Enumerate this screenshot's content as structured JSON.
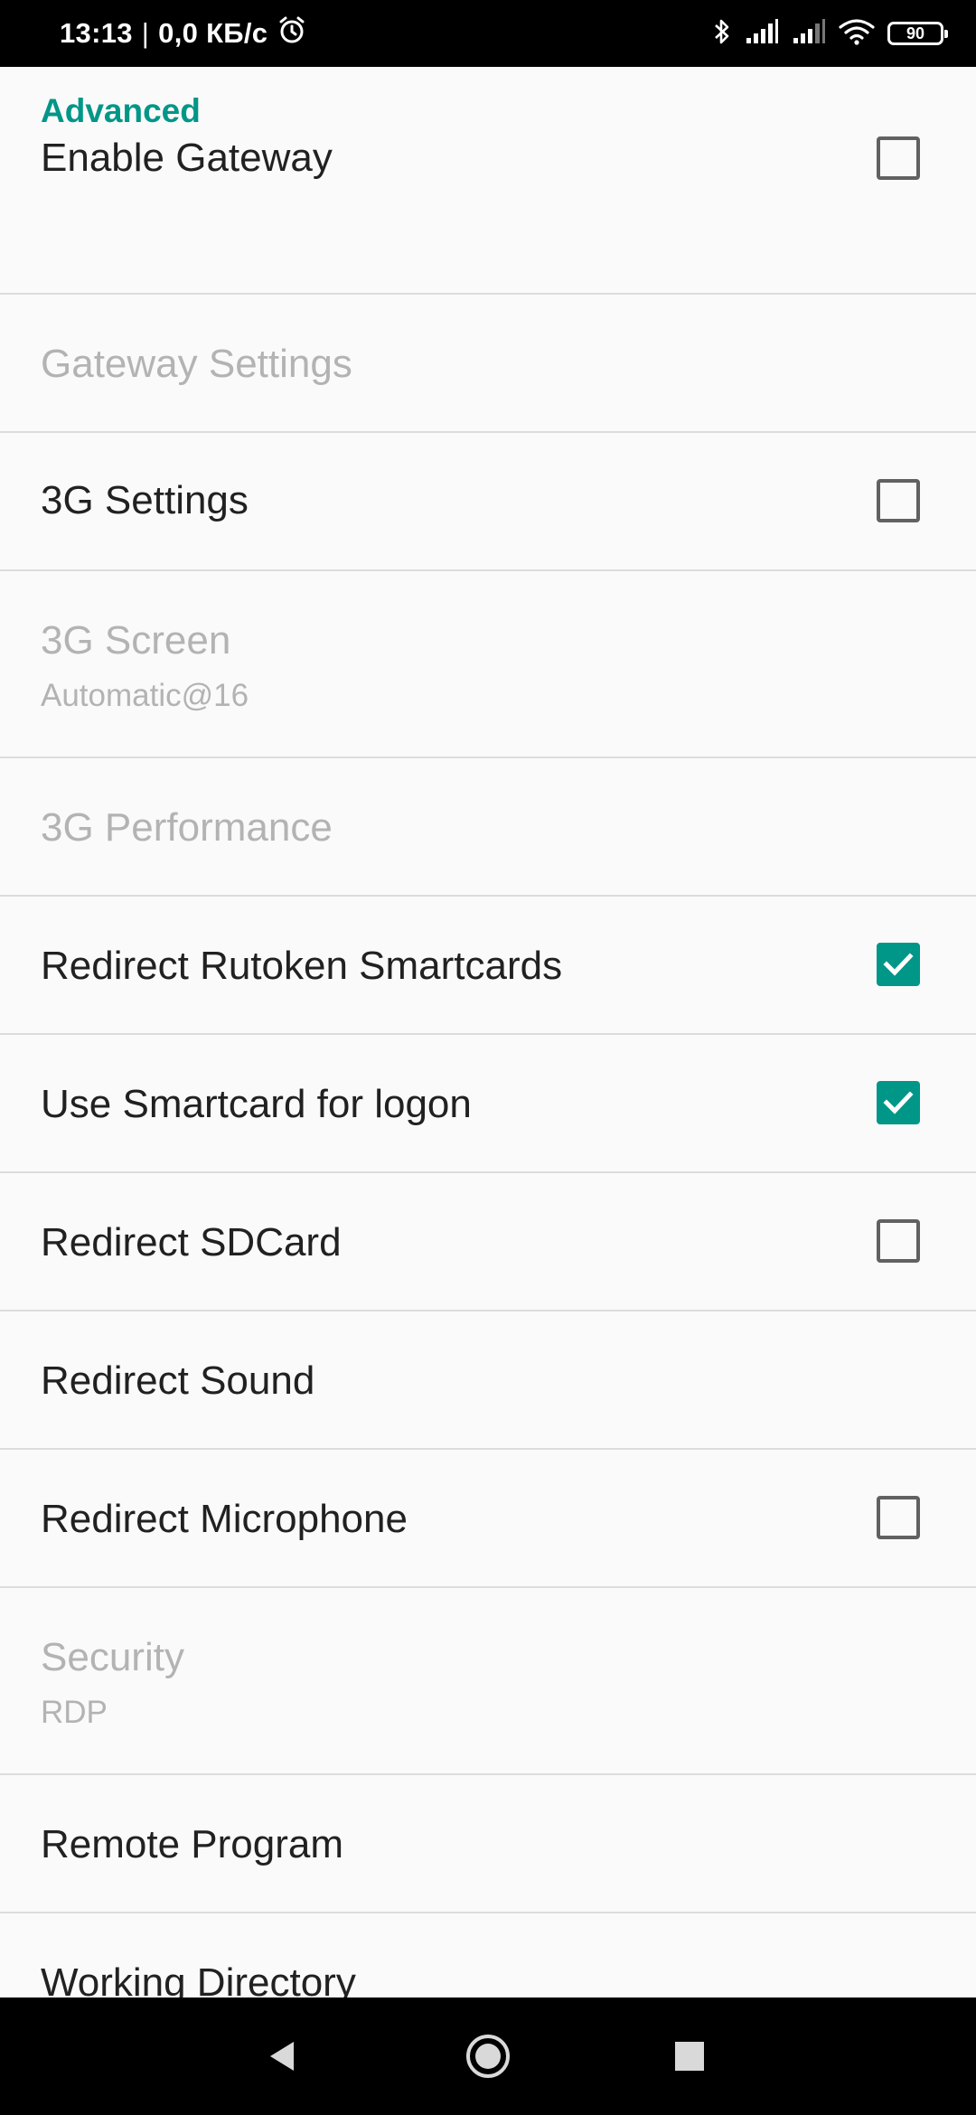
{
  "status_bar": {
    "time": "13:13",
    "separator": "|",
    "network_speed": "0,0 КБ/с",
    "battery_level": "90",
    "icons": [
      "alarm-icon",
      "bluetooth-icon",
      "signal-icon",
      "signal-icon",
      "wifi-icon",
      "battery-icon"
    ]
  },
  "settings": {
    "category": "Advanced",
    "items": [
      {
        "title": "Enable Gateway",
        "enabled": true,
        "checkbox": "unchecked"
      },
      {
        "title": "Gateway Settings",
        "enabled": false
      },
      {
        "title": "3G Settings",
        "enabled": true,
        "checkbox": "unchecked"
      },
      {
        "title": "3G Screen",
        "summary": "Automatic@16",
        "enabled": false
      },
      {
        "title": "3G Performance",
        "enabled": false
      },
      {
        "title": "Redirect Rutoken Smartcards",
        "enabled": true,
        "checkbox": "checked"
      },
      {
        "title": "Use Smartcard for logon",
        "enabled": true,
        "checkbox": "checked"
      },
      {
        "title": "Redirect SDCard",
        "enabled": true,
        "checkbox": "unchecked"
      },
      {
        "title": "Redirect Sound",
        "enabled": true
      },
      {
        "title": "Redirect Microphone",
        "enabled": true,
        "checkbox": "unchecked"
      },
      {
        "title": "Security",
        "summary": "RDP",
        "enabled": false
      },
      {
        "title": "Remote Program",
        "enabled": true
      },
      {
        "title": "Working Directory",
        "enabled": true
      }
    ]
  },
  "colors": {
    "accent": "#009688",
    "title_text": "#212121",
    "disabled_text": "#b3b3b3",
    "divider": "#dcdcdc",
    "background": "#fafafa"
  },
  "nav_bar": {
    "icons": [
      "back-icon",
      "home-icon",
      "recents-icon"
    ]
  }
}
